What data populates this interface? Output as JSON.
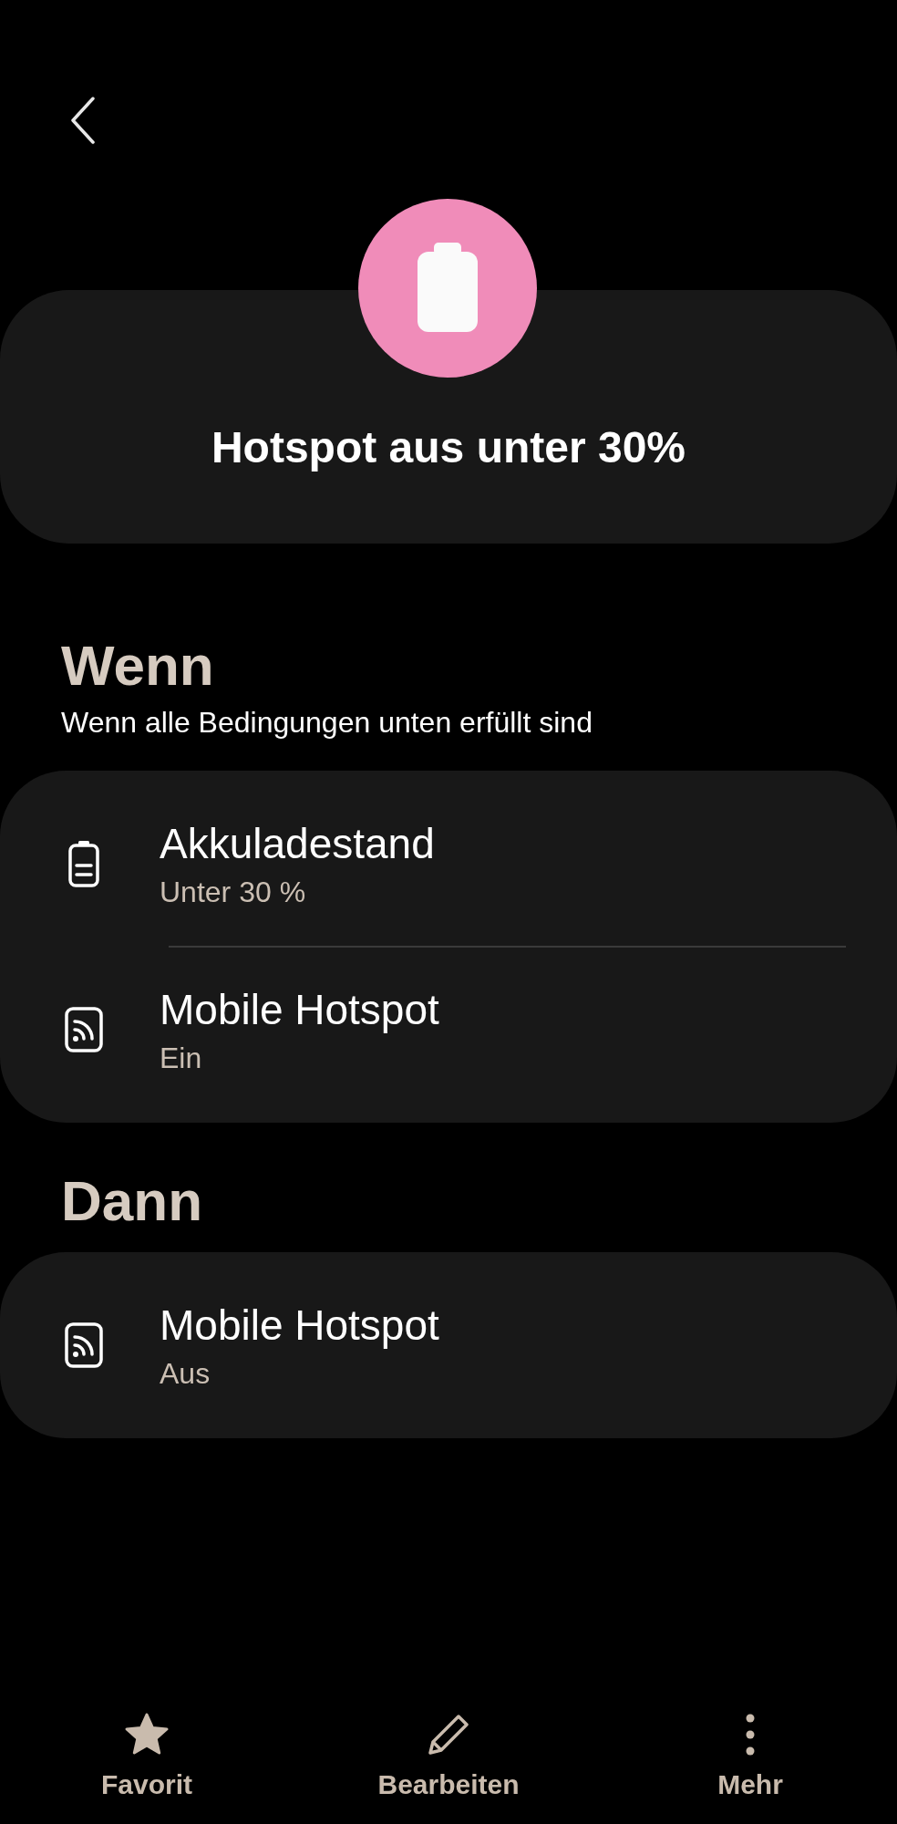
{
  "header": {
    "title": "Hotspot aus unter 30%"
  },
  "conditions": {
    "heading": "Wenn",
    "subtitle": "Wenn alle Bedingungen unten erfüllt sind",
    "items": [
      {
        "kind": "battery",
        "title": "Akkuladestand",
        "value": "Unter 30 %"
      },
      {
        "kind": "hotspot",
        "title": "Mobile Hotspot",
        "value": "Ein"
      }
    ]
  },
  "actions": {
    "heading": "Dann",
    "items": [
      {
        "kind": "hotspot",
        "title": "Mobile Hotspot",
        "value": "Aus"
      }
    ]
  },
  "bottom_bar": [
    {
      "kind": "star",
      "label": "Favorit"
    },
    {
      "kind": "pencil",
      "label": "Bearbeiten"
    },
    {
      "kind": "more",
      "label": "Mehr"
    }
  ]
}
